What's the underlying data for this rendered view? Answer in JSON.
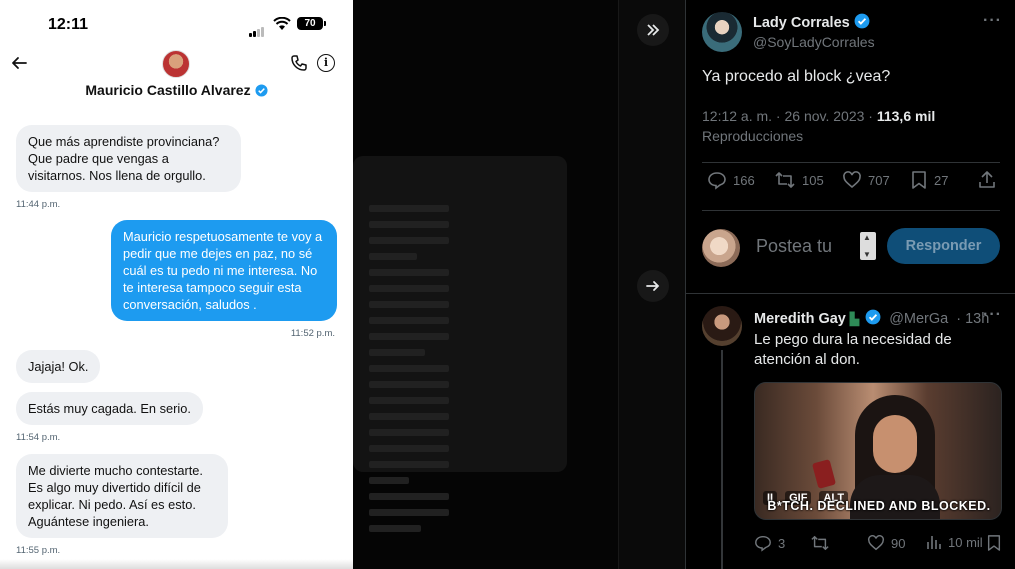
{
  "phone": {
    "status": {
      "time": "12:11",
      "battery": "70"
    },
    "contact": {
      "name": "Mauricio Castillo Alvarez"
    },
    "messages": [
      {
        "from": "them",
        "text": "Que más aprendiste provinciana? Que padre que vengas a visitarnos. Nos llena de orgullo.",
        "time": "11:44 p.m."
      },
      {
        "from": "me",
        "text": "Mauricio respetuosamente te voy a pedir que me dejes en paz, no sé cuál es tu pedo ni me interesa. No te interesa tampoco seguir esta conversación, saludos .",
        "time": "11:52 p.m."
      },
      {
        "from": "them",
        "text": "Jajaja! Ok."
      },
      {
        "from": "them",
        "text": "Estás muy cagada. En serio.",
        "time": "11:54 p.m."
      },
      {
        "from": "them",
        "text": "Me divierte mucho contestarte. Es algo muy divertido difícil de explicar. Ni pedo. Así es esto. Aguántese ingeniera.",
        "time": "11:55 p.m."
      }
    ]
  },
  "tweet": {
    "author": "Lady Corrales",
    "handle": "@SoyLadyCorrales",
    "text": "Ya procedo al block ¿vea?",
    "meta": "12:12 a. m. · 26 nov. 2023 · ",
    "views_count": "113,6 mil",
    "views_label": "Reproducciones",
    "stats": {
      "replies": "166",
      "retweets": "105",
      "likes": "707",
      "bookmarks": "27"
    },
    "reply_placeholder": "Postea tu",
    "reply_button": "Responder"
  },
  "comment": {
    "author": "Meredith Gay",
    "handle": "@MerGa",
    "age": "· 13h",
    "text": "Le pego dura la necesidad de atención al don.",
    "gif": {
      "pause": "II",
      "gif_label": "GIF",
      "alt_label": "ALT",
      "caption": "B*TCH. DECLINED AND BLOCKED."
    },
    "stats": {
      "replies": "3",
      "likes": "90",
      "views": "10 mil"
    }
  },
  "colors": {
    "accent": "#1d9bf0",
    "bubble_in": "#eef0f3",
    "muted": "#71767b",
    "reply_btn": "#0f4e78"
  }
}
